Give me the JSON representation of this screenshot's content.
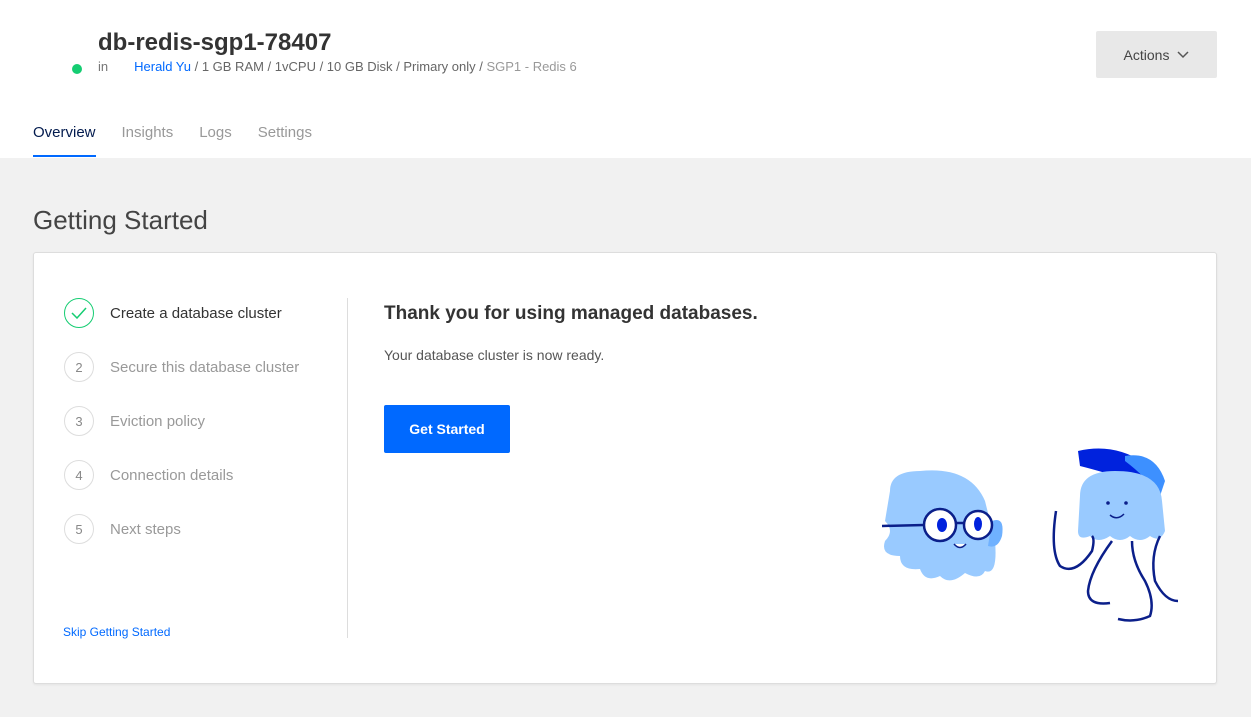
{
  "header": {
    "title": "db-redis-sgp1-78407",
    "status": "online",
    "status_color": "#15cd72",
    "in_label": "in",
    "owner": "Herald Yu",
    "specs": " / 1 GB RAM / 1vCPU / 10 GB Disk / Primary only / ",
    "region": "SGP1 - Redis 6",
    "actions_label": "Actions"
  },
  "tabs": [
    {
      "label": "Overview",
      "active": true
    },
    {
      "label": "Insights"
    },
    {
      "label": "Logs"
    },
    {
      "label": "Settings"
    }
  ],
  "section_title": "Getting Started",
  "steps": [
    {
      "num": "✓",
      "label": "Create a database cluster",
      "done": true
    },
    {
      "num": "2",
      "label": "Secure this database cluster"
    },
    {
      "num": "3",
      "label": "Eviction policy"
    },
    {
      "num": "4",
      "label": "Connection details"
    },
    {
      "num": "5",
      "label": "Next steps"
    }
  ],
  "skip_label": "Skip Getting Started",
  "main": {
    "title": "Thank you for using managed databases.",
    "subtitle": "Your database cluster is now ready.",
    "button_label": "Get Started"
  },
  "accent": "#0069ff"
}
